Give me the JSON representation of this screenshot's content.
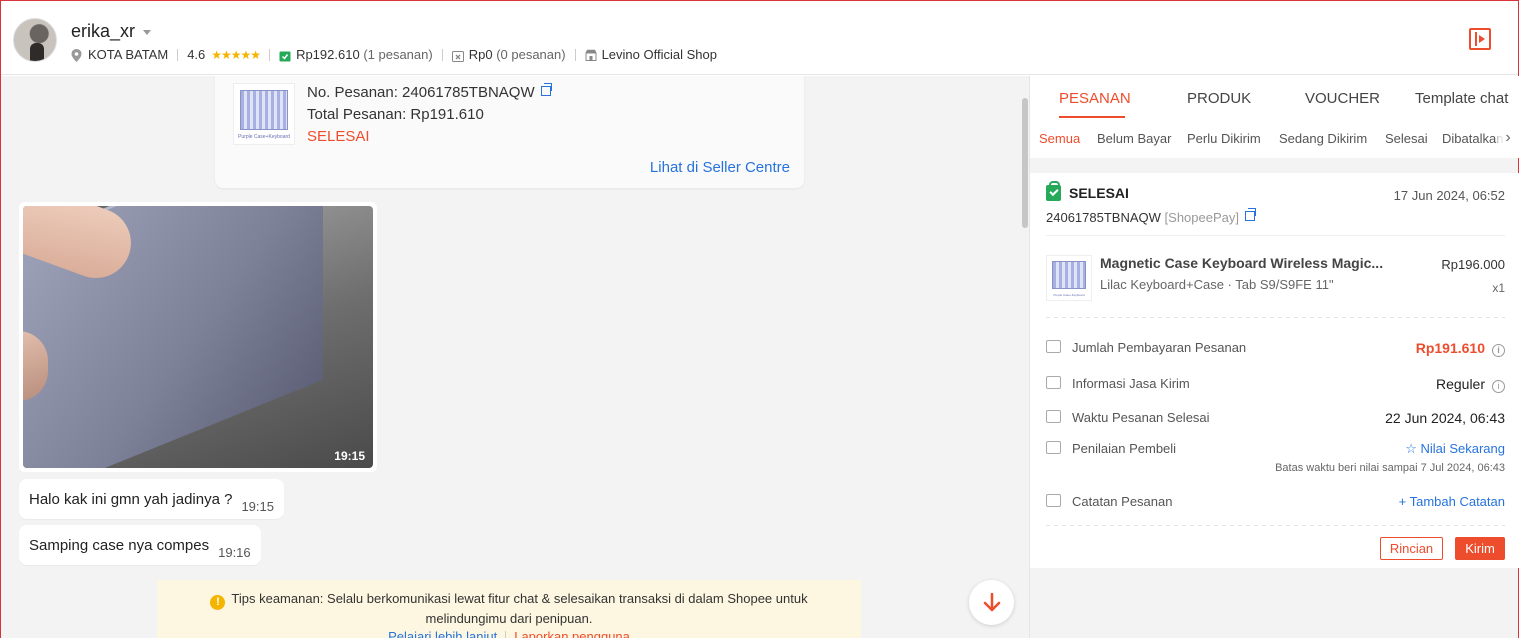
{
  "header": {
    "username": "erika_xr",
    "location": "KOTA BATAM",
    "rating": "4.6",
    "stars": "★★★★★",
    "spent_value": "Rp192.610",
    "spent_count": "(1 pesanan)",
    "unpaid_value": "Rp0",
    "unpaid_count": "(0 pesanan)",
    "shop": "Levino Official Shop"
  },
  "chat": {
    "order_card": {
      "thumb_caption": "Purple Case+Keyboard",
      "order_no": "No. Pesanan: 24061785TBNAQW",
      "total": "Total Pesanan: Rp191.610",
      "status": "SELESAI",
      "link": "Lihat di Seller Centre"
    },
    "photo_time": "19:15",
    "messages": [
      {
        "text": "Halo kak ini gmn yah jadinya ?",
        "time": "19:15"
      },
      {
        "text": "Samping case nya compes",
        "time": "19:16"
      }
    ],
    "tips": {
      "line1": "Tips keamanan: Selalu berkomunikasi lewat fitur chat & selesaikan transaksi di dalam Shopee untuk",
      "line2": "melindungimu dari penipuan.",
      "learn_more": "Pelajari lebih lanjut",
      "report": "Laporkan pengguna"
    }
  },
  "panel": {
    "tabs": [
      "PESANAN",
      "PRODUK",
      "VOUCHER",
      "Template chat"
    ],
    "subtabs": [
      "Semua",
      "Belum Bayar",
      "Perlu Dikirim",
      "Sedang Dikirim",
      "Selesai",
      "Dibatalkan"
    ],
    "order": {
      "status": "SELESAI",
      "date": "17 Jun 2024, 06:52",
      "order_id": "24061785TBNAQW",
      "payment": "[ShopeePay]",
      "thumb_caption": "Purple Case+Keyboard",
      "product_name": "Magnetic Case Keyboard Wireless Magic...",
      "variant": "Lilac Keyboard+Case · Tab S9/S9FE 11\"",
      "price": "Rp196.000",
      "qty": "x1",
      "rows": {
        "payment_label": "Jumlah Pembayaran Pesanan",
        "payment_value": "Rp191.610",
        "shipping_label": "Informasi Jasa Kirim",
        "shipping_value": "Reguler",
        "complete_label": "Waktu Pesanan Selesai",
        "complete_value": "22 Jun 2024, 06:43",
        "rating_label": "Penilaian Pembeli",
        "rating_value": "☆ Nilai Sekarang",
        "rating_note": "Batas waktu beri nilai sampai 7 Jul 2024, 06:43",
        "note_label": "Catatan Pesanan",
        "note_value": "+ Tambah Catatan"
      },
      "btn_detail": "Rincian",
      "btn_send": "Kirim"
    }
  },
  "colors": {
    "accent": "#ee4d2d",
    "link": "#2673dd",
    "success": "#26aa5a"
  }
}
